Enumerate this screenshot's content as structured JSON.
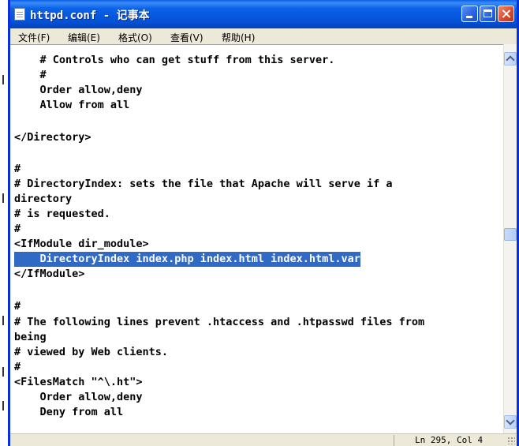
{
  "window": {
    "title": "httpd.conf - 记事本"
  },
  "menu": [
    "文件(F)",
    "编辑(E)",
    "格式(O)",
    "查看(V)",
    "帮助(H)"
  ],
  "editor": {
    "lines": [
      "    # Controls who can get stuff from this server.",
      "    #",
      "    Order allow,deny",
      "    Allow from all",
      "",
      "</Directory>",
      "",
      "#",
      "# DirectoryIndex: sets the file that Apache will serve if a",
      "directory",
      "# is requested.",
      "#",
      "<IfModule dir_module>",
      "    DirectoryIndex index.php index.html index.html.var",
      "</IfModule>",
      "",
      "#",
      "# The following lines prevent .htaccess and .htpasswd files from",
      "being",
      "# viewed by Web clients.",
      "#",
      "<FilesMatch \"^\\.ht\">",
      "    Order allow,deny",
      "    Deny from all"
    ],
    "selected_line_index": 13
  },
  "status": {
    "position": "Ln 295, Col 4"
  },
  "colors": {
    "titlebar": "#0552d8",
    "selection": "#316ac5",
    "chrome": "#ece9d8"
  }
}
